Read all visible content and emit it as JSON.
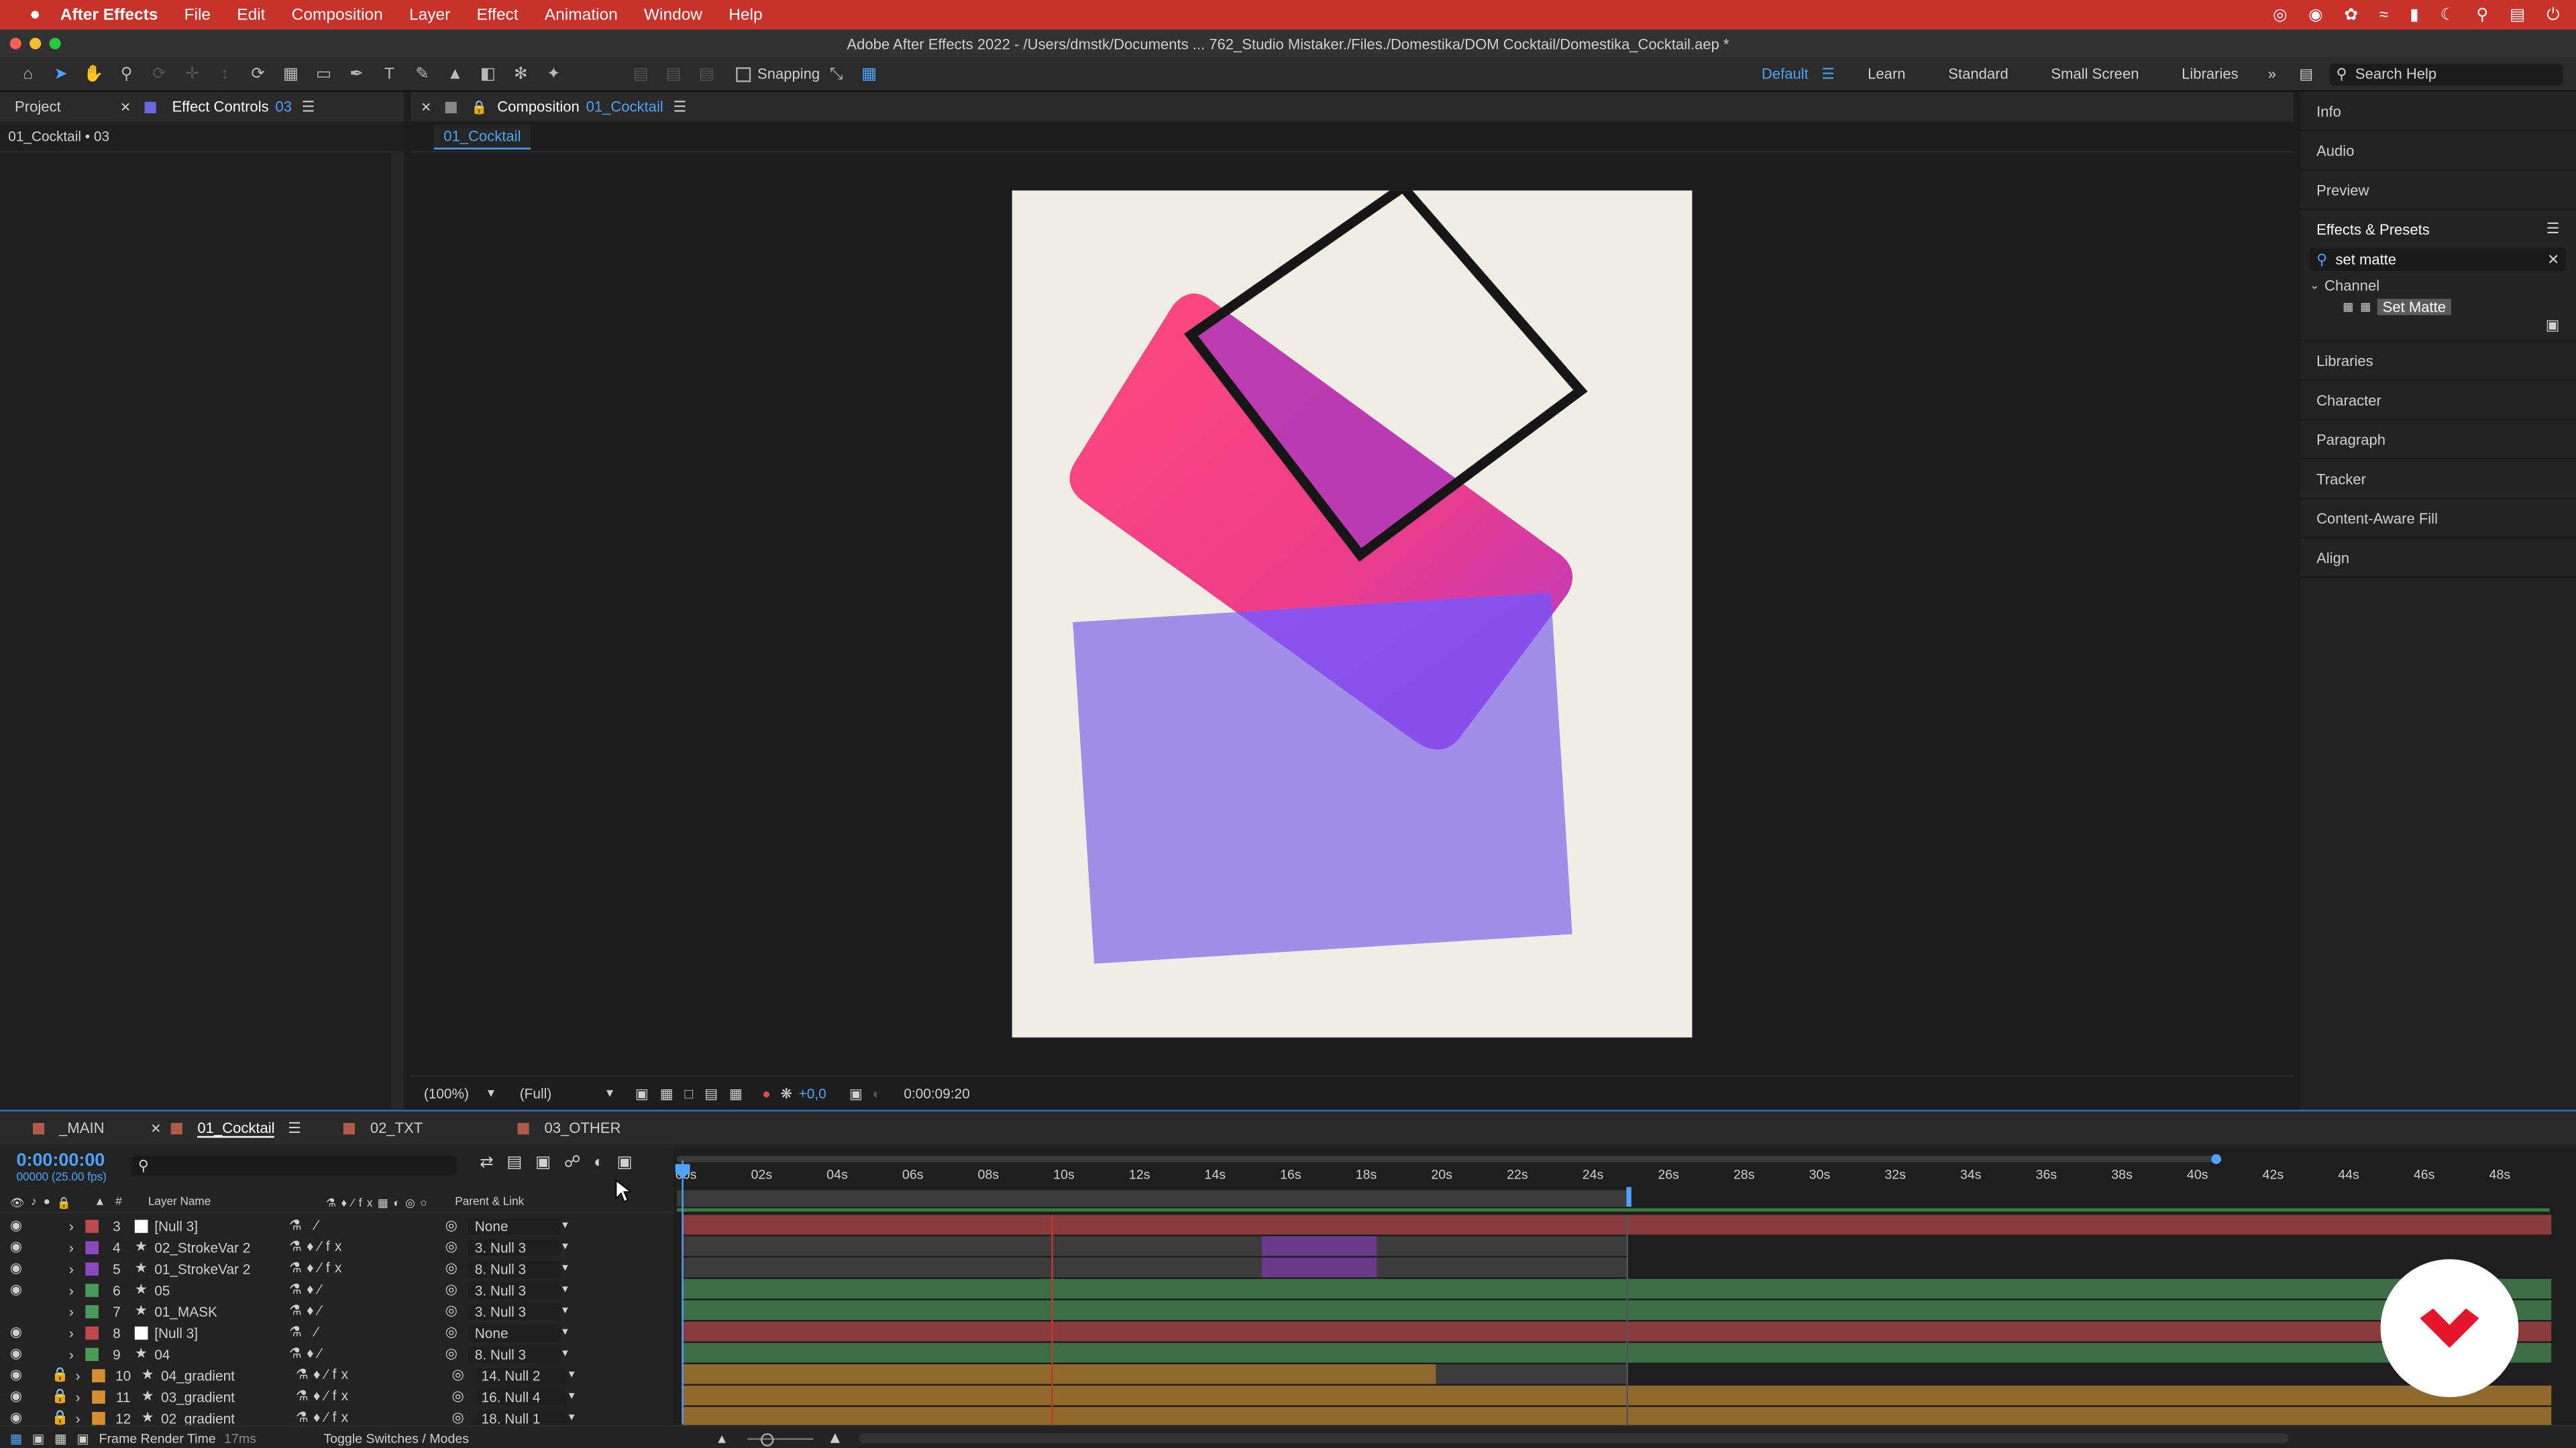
{
  "menubar": {
    "app_name": "After Effects",
    "items": [
      "File",
      "Edit",
      "Composition",
      "Layer",
      "Effect",
      "Animation",
      "Window",
      "Help"
    ]
  },
  "title": "Adobe After Effects 2022 - /Users/dmstk/Documents ... 762_Studio Mistaker./Files./Domestika/DOM Cocktail/Domestika_Cocktail.aep *",
  "toolbar": {
    "snapping_label": "Snapping",
    "workspaces": [
      "Default",
      "Learn",
      "Standard",
      "Small Screen",
      "Libraries"
    ],
    "active_workspace": "Default",
    "search_placeholder": "Search Help"
  },
  "left_panel": {
    "tab_project": "Project",
    "tab_effect_controls": "Effect Controls",
    "tab_effect_controls_layer": "03",
    "breadcrumb": "01_Cocktail • 03"
  },
  "composition": {
    "tab_prefix": "Composition",
    "tab_name": "01_Cocktail",
    "subtab": "01_Cocktail",
    "zoom": "(100%)",
    "resolution": "(Full)",
    "exposure": "+0,0",
    "timecode": "0:00:09:20",
    "colors": {
      "bg": "#efede4",
      "pink": "#ff4a80",
      "purple_overlap": "#a63cc0",
      "violet": "#a08ee8",
      "stroke": "#161616"
    }
  },
  "right_panel": {
    "items_top": [
      "Info",
      "Audio",
      "Preview"
    ],
    "effects_title": "Effects & Presets",
    "search_value": "set matte",
    "category": "Channel",
    "effect": "Set Matte",
    "items_bottom": [
      "Libraries",
      "Character",
      "Paragraph",
      "Tracker",
      "Content-Aware Fill",
      "Align"
    ]
  },
  "timeline": {
    "tabs": [
      {
        "label": "_MAIN",
        "color": "#b05a4a"
      },
      {
        "label": "01_Cocktail",
        "color": "#b05a4a"
      },
      {
        "label": "02_TXT",
        "color": "#b05a4a"
      },
      {
        "label": "03_OTHER",
        "color": "#b05a4a"
      }
    ],
    "active_tab": "01_Cocktail",
    "current_time": "0:00:00:00",
    "frame_info": "00000 (25.00 fps)",
    "col_num": "#",
    "col_layer_name": "Layer Name",
    "col_parent": "Parent & Link",
    "ruler": [
      "00s",
      "02s",
      "04s",
      "06s",
      "08s",
      "10s",
      "12s",
      "14s",
      "16s",
      "18s",
      "20s",
      "22s",
      "24s",
      "26s",
      "28s",
      "30s",
      "32s",
      "34s",
      "36s",
      "38s",
      "40s",
      "42s",
      "44s",
      "46s",
      "48s"
    ],
    "layers": [
      {
        "num": "3",
        "name": "[Null 3]",
        "parent": "None",
        "label": "#c04a4a",
        "bar": "#8a3c3c",
        "locked": false
      },
      {
        "num": "4",
        "name": "02_StrokeVar 2",
        "parent": "3. Null 3",
        "label": "#8a4abf",
        "bar": "#4a4a4a",
        "locked": false
      },
      {
        "num": "5",
        "name": "01_StrokeVar 2",
        "parent": "8. Null 3",
        "label": "#8a4abf",
        "bar": "#4a4a4a",
        "locked": false
      },
      {
        "num": "6",
        "name": "05",
        "parent": "3. Null 3",
        "label": "#4a9a5a",
        "bar": "#3e6e45",
        "locked": false
      },
      {
        "num": "7",
        "name": "01_MASK",
        "parent": "3. Null 3",
        "label": "#4a9a5a",
        "bar": "#3e6e45",
        "locked": false
      },
      {
        "num": "8",
        "name": "[Null 3]",
        "parent": "None",
        "label": "#c04a4a",
        "bar": "#8a3c3c",
        "locked": false
      },
      {
        "num": "9",
        "name": "04",
        "parent": "8. Null 3",
        "label": "#4a9a5a",
        "bar": "#3e6e45",
        "locked": false
      },
      {
        "num": "10",
        "name": "04_gradient",
        "parent": "14. Null 2",
        "label": "#d4902e",
        "bar": "#8f6a2c",
        "locked": true
      },
      {
        "num": "11",
        "name": "03_gradient",
        "parent": "16. Null 4",
        "label": "#d4902e",
        "bar": "#8f6a2c",
        "locked": true
      },
      {
        "num": "12",
        "name": "02_gradient",
        "parent": "18. Null 1",
        "label": "#d4902e",
        "bar": "#8f6a2c",
        "locked": true
      }
    ],
    "footer_render_label": "Frame Render Time",
    "footer_render_value": "17ms",
    "footer_toggle": "Toggle Switches / Modes"
  }
}
